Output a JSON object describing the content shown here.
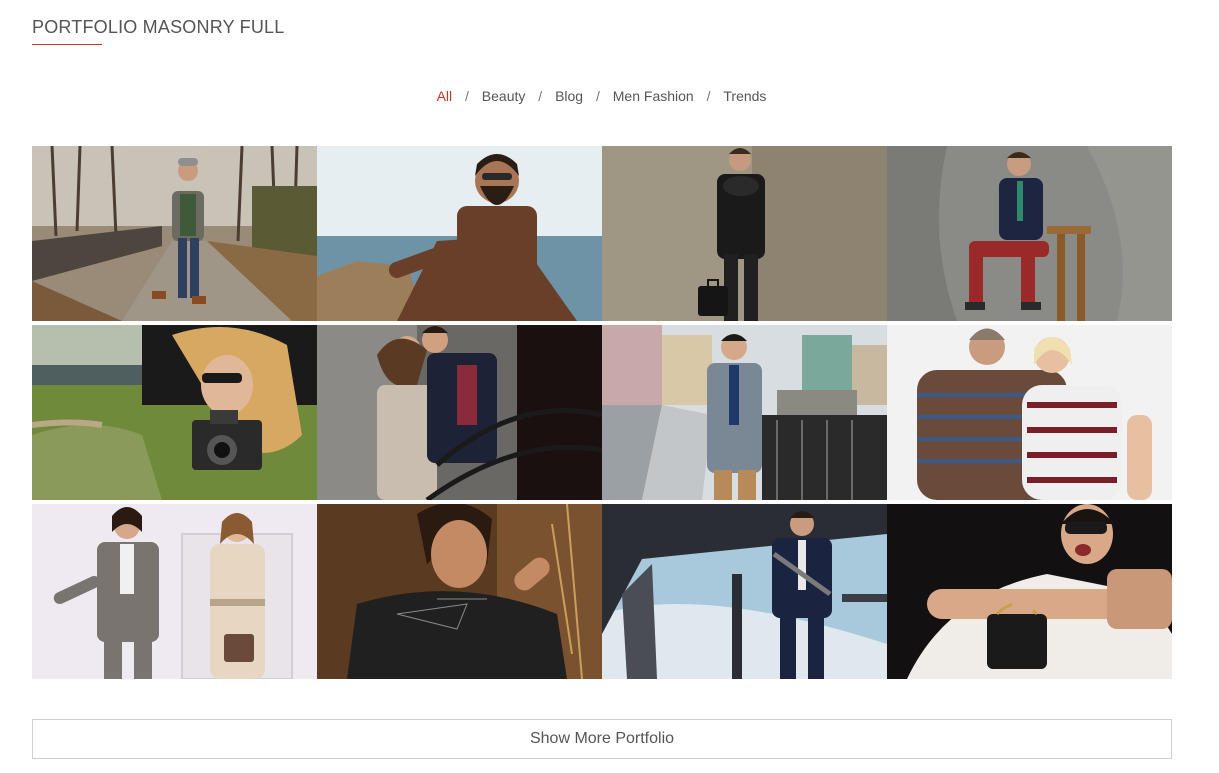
{
  "section": {
    "title": "PORTFOLIO MASONRY FULL"
  },
  "filters": [
    {
      "label": "All",
      "active": true
    },
    {
      "label": "Beauty",
      "active": false
    },
    {
      "label": "Blog",
      "active": false
    },
    {
      "label": "Men Fashion",
      "active": false
    },
    {
      "label": "Trends",
      "active": false
    }
  ],
  "portfolio_items": [
    {
      "image": "man-walking-park-photo"
    },
    {
      "image": "bearded-man-seaside-photo"
    },
    {
      "image": "man-leather-jacket-photo"
    },
    {
      "image": "man-seated-stool-photo"
    },
    {
      "image": "woman-with-camera-photo"
    },
    {
      "image": "couple-on-stairs-photo"
    },
    {
      "image": "man-city-bridge-photo"
    },
    {
      "image": "couple-striped-sweaters-photo"
    },
    {
      "image": "couple-trench-coats-photo"
    },
    {
      "image": "man-dark-tshirt-photo"
    },
    {
      "image": "man-under-overpass-photo"
    },
    {
      "image": "woman-sunglasses-handbag-photo"
    }
  ],
  "show_more": {
    "label": "Show More Portfolio"
  },
  "colors": {
    "accent": "#c0392b",
    "text": "#555555",
    "border": "#cfcfcf"
  }
}
